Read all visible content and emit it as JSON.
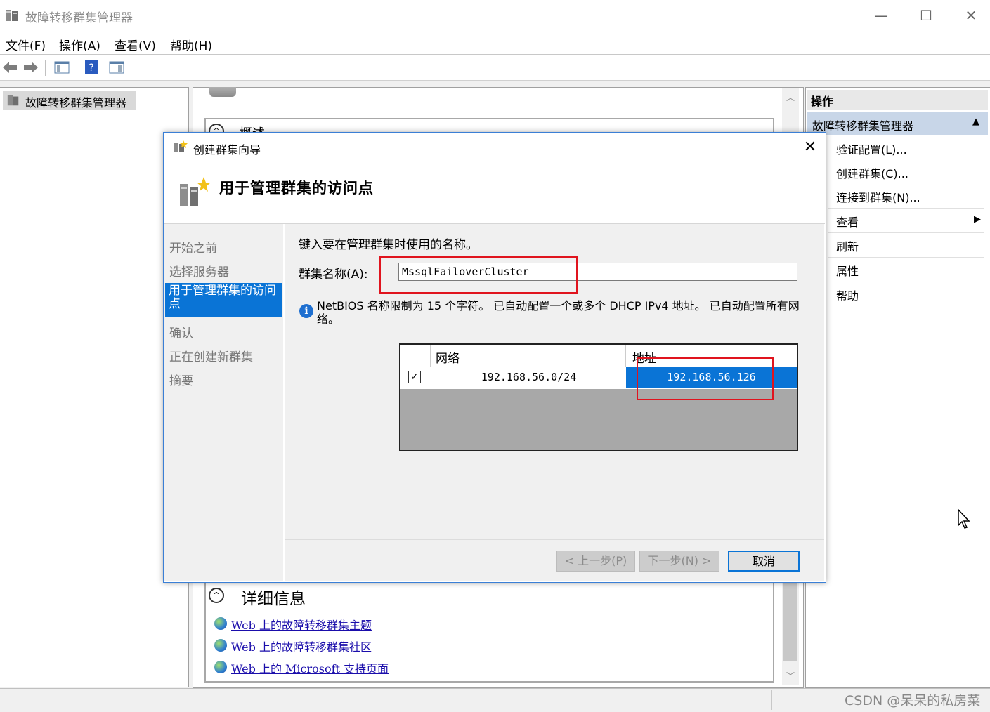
{
  "window": {
    "title": "故障转移群集管理器",
    "minimize": "—",
    "maximize": "☐",
    "close": "✕"
  },
  "menu": [
    "文件(F)",
    "操作(A)",
    "查看(V)",
    "帮助(H)"
  ],
  "tree": {
    "root_label": "故障转移群集管理器"
  },
  "center": {
    "overview_title": "概述",
    "details_title": "详细信息",
    "links": [
      "Web 上的故障转移群集主题",
      "Web 上的故障转移群集社区",
      "Web 上的 Microsoft 支持页面"
    ]
  },
  "actions": {
    "header": "操作",
    "section": "故障转移群集管理器",
    "items": [
      "验证配置(L)...",
      "创建群集(C)...",
      "连接到群集(N)...",
      "查看",
      "刷新",
      "属性",
      "帮助"
    ]
  },
  "wizard": {
    "title": "创建群集向导",
    "heading": "用于管理群集的访问点",
    "steps": [
      "开始之前",
      "选择服务器",
      "用于管理群集的访问点",
      "确认",
      "正在创建新群集",
      "摘要"
    ],
    "active_step": 2,
    "instruction": "键入要在管理群集时使用的名称。",
    "name_label": "群集名称(A):",
    "name_value": "MssqlFailoverCluster",
    "info": "NetBIOS 名称限制为 15 个字符。 已自动配置一个或多个 DHCP IPv4 地址。 已自动配置所有网络。",
    "table": {
      "columns": [
        "网络",
        "地址"
      ],
      "rows": [
        {
          "checked": true,
          "network": "192.168.56.0/24",
          "address": "192.168.56.126"
        }
      ]
    },
    "buttons": {
      "back": "< 上一步(P)",
      "next": "下一步(N) >",
      "cancel": "取消"
    }
  },
  "watermark": "CSDN @呆呆的私房菜",
  "colors": {
    "accent": "#0a74d6",
    "highlight": "#e0141e"
  }
}
